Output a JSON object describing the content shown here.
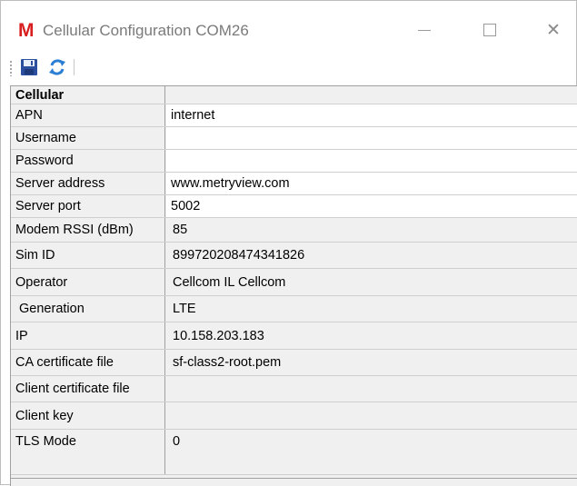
{
  "window": {
    "logo_letter": "M",
    "title": "Cellular Configuration COM26",
    "close_glyph": "✕"
  },
  "toolbar": {
    "save_icon": "floppy-disk-icon",
    "refresh_icon": "refresh-icon"
  },
  "grid": {
    "category": "Cellular",
    "rows": [
      {
        "name": "APN",
        "value": "internet"
      },
      {
        "name": "Username",
        "value": ""
      },
      {
        "name": "Password",
        "value": ""
      },
      {
        "name": "Server address",
        "value": "www.metryview.com"
      },
      {
        "name": "Server port",
        "value": "5002"
      },
      {
        "name": "Modem RSSI (dBm)",
        "value": "85"
      },
      {
        "name": "Sim ID",
        "value": "899720208474341826"
      },
      {
        "name": "Operator",
        "value": "Cellcom IL Cellcom"
      },
      {
        "name": " Generation",
        "value": "LTE"
      },
      {
        "name": "IP",
        "value": "10.158.203.183"
      },
      {
        "name": "CA certificate file",
        "value": "sf-class2-root.pem"
      },
      {
        "name": "Client certificate file",
        "value": ""
      },
      {
        "name": "Client key",
        "value": ""
      },
      {
        "name": "TLS Mode",
        "value": "0"
      }
    ]
  },
  "colors": {
    "logo": "#d81e1e",
    "title_text": "#7a7a7a",
    "save_icon_blue": "#2b4f9e",
    "refresh_icon_blue": "#2a7fd4"
  }
}
